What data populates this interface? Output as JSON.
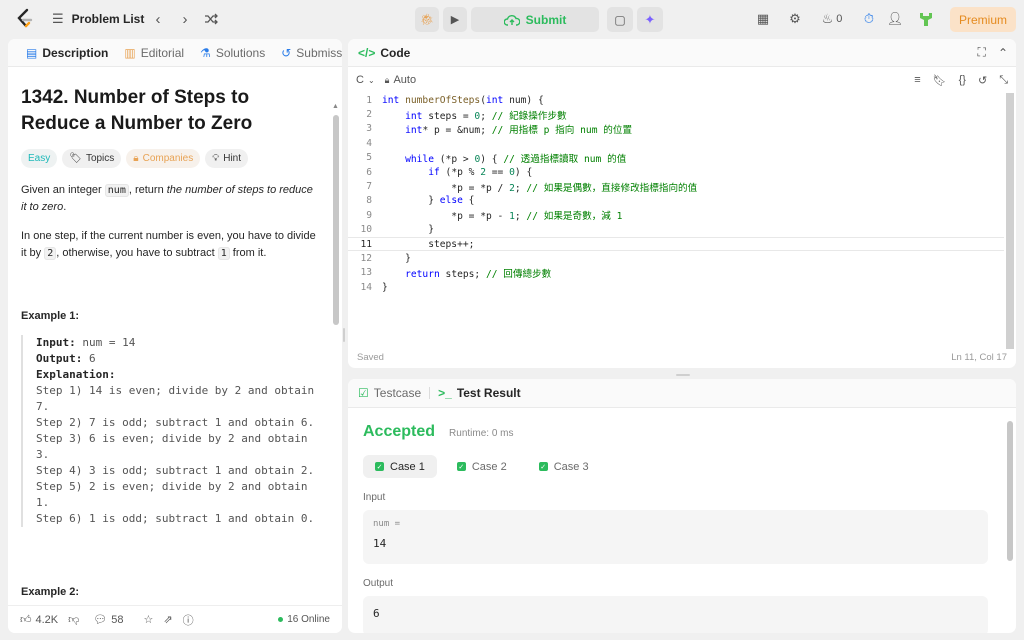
{
  "topbar": {
    "problem_list": "Problem List",
    "submit": "Submit",
    "streak": "0",
    "premium": "Premium"
  },
  "desc": {
    "tabs": [
      "Description",
      "Editorial",
      "Solutions",
      "Submissions"
    ],
    "title": "1342. Number of Steps to Reduce a Number to Zero",
    "chips": {
      "easy": "Easy",
      "topics": "Topics",
      "companies": "Companies",
      "hint": "Hint"
    },
    "p1_a": "Given an integer ",
    "p1_code": "num",
    "p1_b": ", return ",
    "p1_em": "the number of steps to reduce it to zero",
    "p1_c": ".",
    "p2_a": "In one step, if the current number is even, you have to divide it by ",
    "p2_code1": "2",
    "p2_b": ", otherwise, you have to subtract ",
    "p2_code2": "1",
    "p2_c": " from it.",
    "example1_title": "Example 1:",
    "example1": {
      "input_label": "Input:",
      "input_val": " num = 14",
      "output_label": "Output:",
      "output_val": " 6",
      "explanation_label": "Explanation:",
      "steps": [
        "Step 1) 14 is even; divide by 2 and obtain 7.",
        "Step 2) 7 is odd; subtract 1 and obtain 6.",
        "Step 3) 6 is even; divide by 2 and obtain 3.",
        "Step 4) 3 is odd; subtract 1 and obtain 2.",
        "Step 5) 2 is even; divide by 2 and obtain 1.",
        "Step 6) 1 is odd; subtract 1 and obtain 0."
      ]
    },
    "example2_title": "Example 2:",
    "footer": {
      "likes": "4.2K",
      "comments": "58",
      "online": "16 Online"
    }
  },
  "code": {
    "tab": "Code",
    "language": "C",
    "auto": "Auto",
    "status_left": "Saved",
    "status_right": "Ln 11, Col 17",
    "current_line": 11
  },
  "tests": {
    "tabs": [
      "Testcase",
      "Test Result"
    ],
    "accepted": "Accepted",
    "runtime": "Runtime: 0 ms",
    "cases": [
      "Case 1",
      "Case 2",
      "Case 3"
    ],
    "input_label": "Input",
    "input_var": "num =",
    "input_val": "14",
    "output_label": "Output",
    "output_val": "6"
  },
  "colors": {
    "accent_green": "#2cbb5d",
    "premium": "#e58b20",
    "keyword": "#0000ff",
    "comment": "#008000"
  }
}
